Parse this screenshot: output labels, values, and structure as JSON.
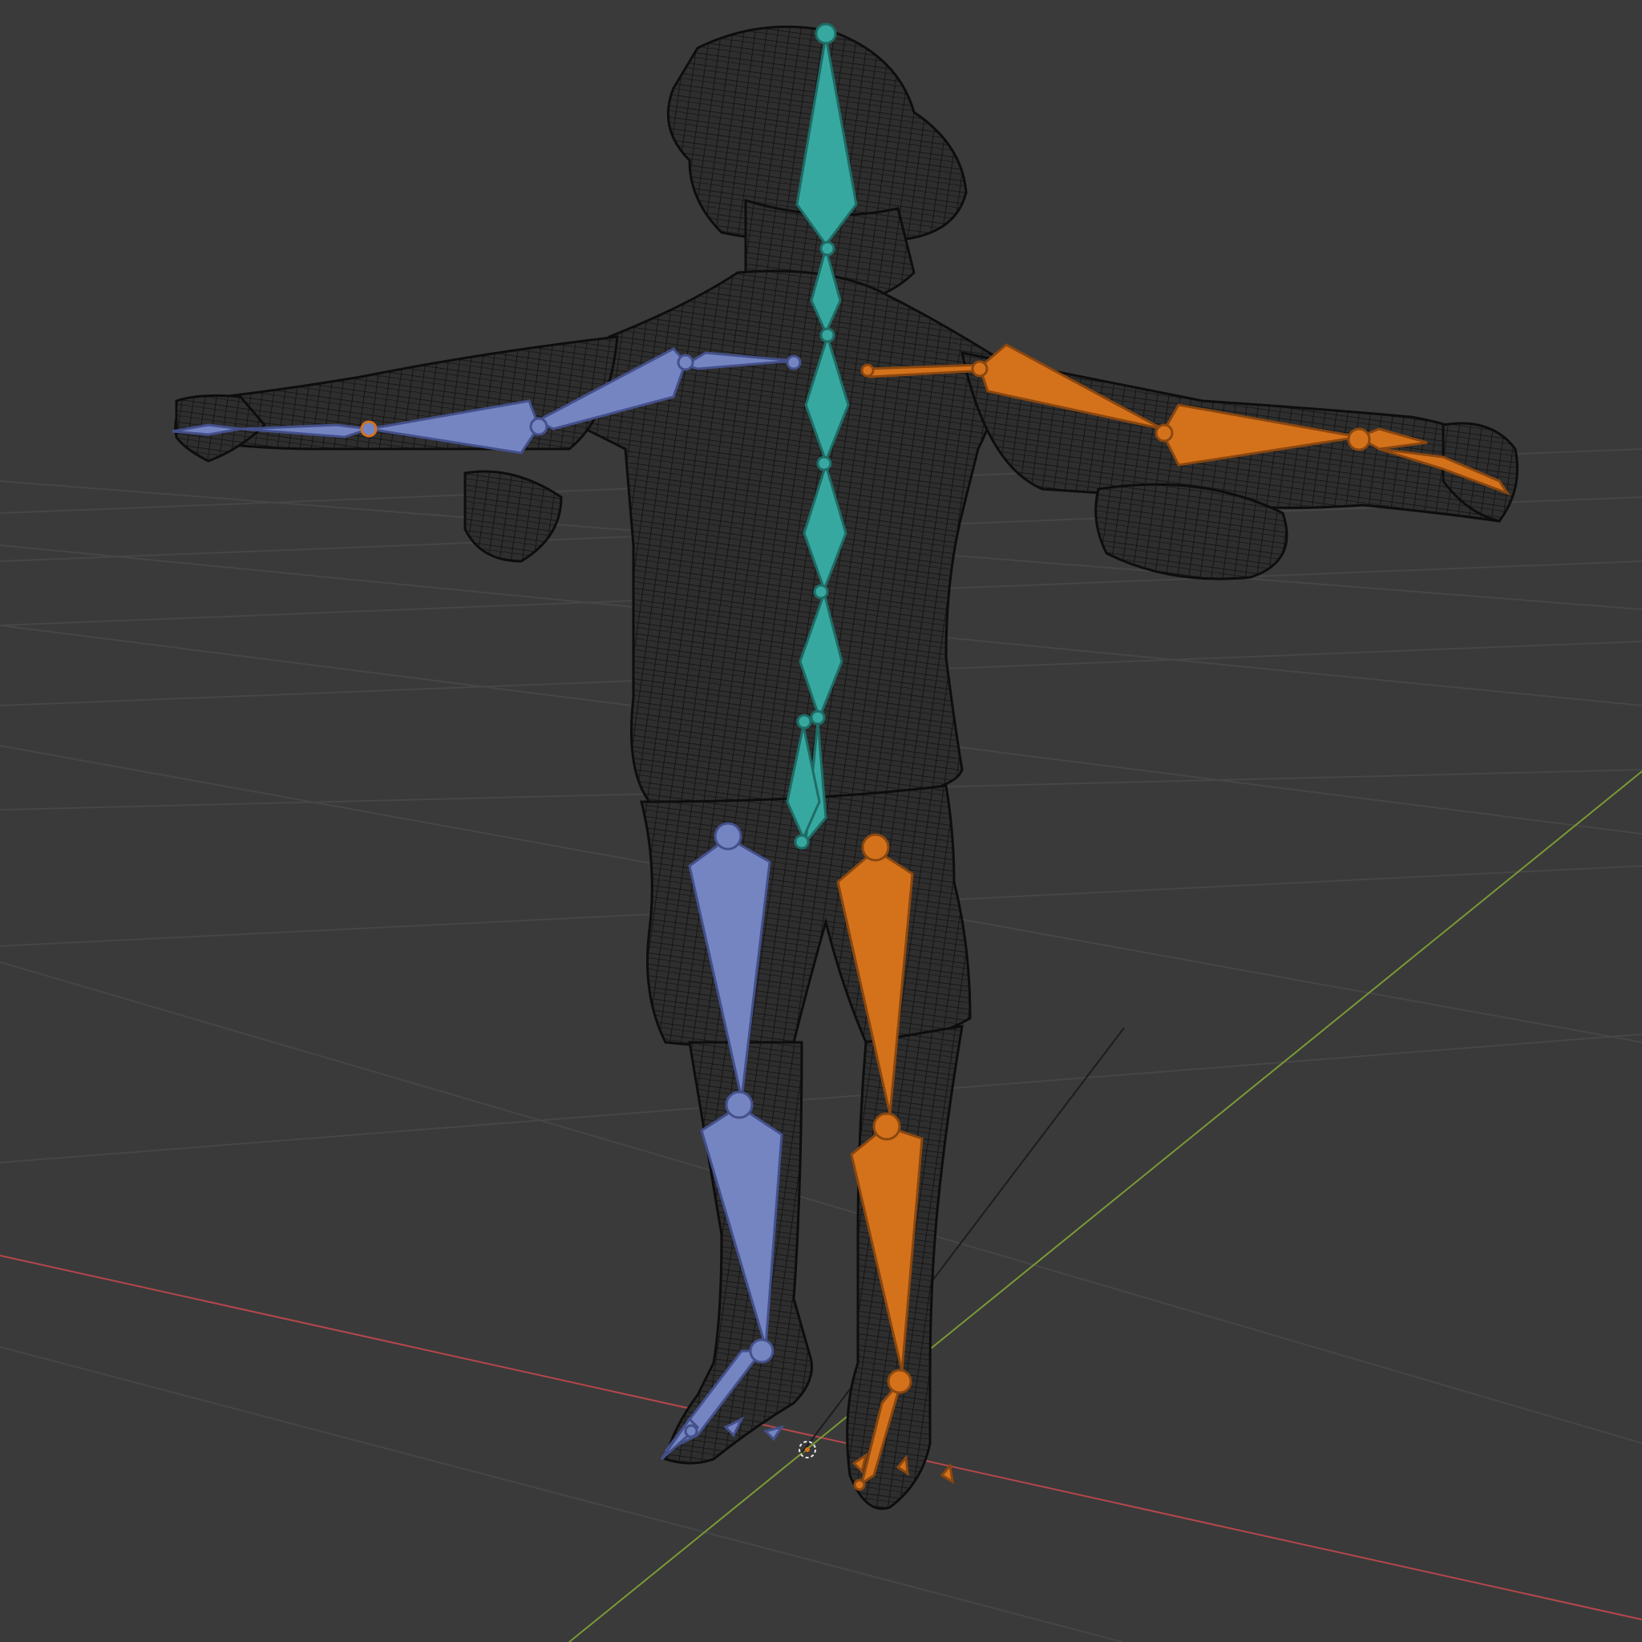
{
  "viewport": {
    "background": "#3a3a3a",
    "grid_color": "#454545",
    "axis_x_color": "#b5474c",
    "axis_y_color": "#7a9a34",
    "axis_z_color": "#222222"
  },
  "mesh": {
    "wire_color": "#101010",
    "fill_color": "#2c2c2c",
    "display": "wireframe"
  },
  "armature": {
    "center_color": "#37a8a0",
    "left_color": "#7485c2",
    "right_color": "#d4721c",
    "bones": {
      "spine": [
        "head",
        "neck",
        "chest-upper",
        "chest",
        "spine-upper",
        "spine",
        "hips"
      ],
      "left": [
        "shoulder",
        "upper-arm",
        "forearm",
        "hand",
        "thigh",
        "shin",
        "foot",
        "toe"
      ],
      "right": [
        "shoulder",
        "upper-arm",
        "forearm",
        "hand",
        "thigh",
        "shin",
        "foot",
        "toe"
      ]
    }
  }
}
